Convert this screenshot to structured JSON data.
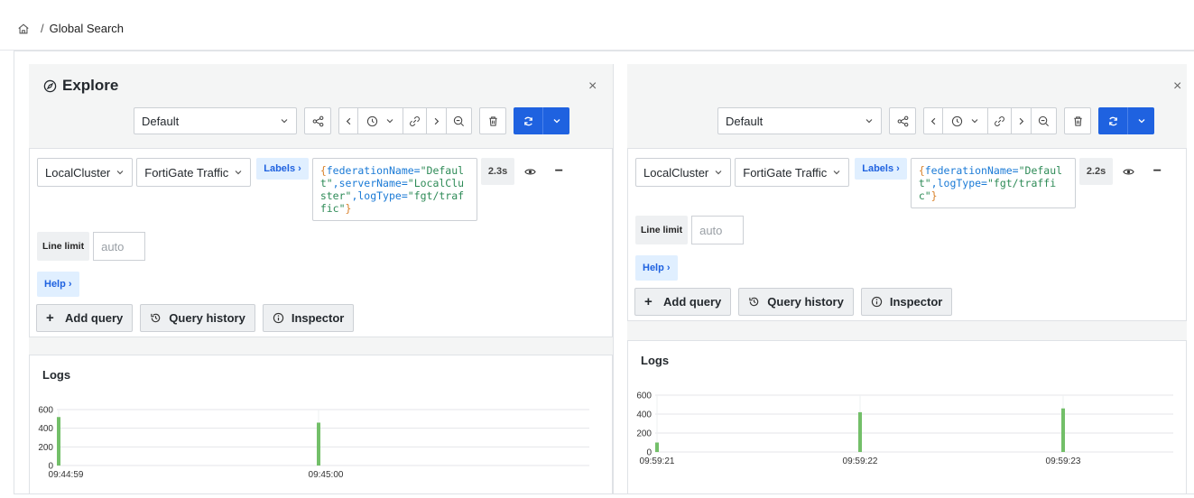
{
  "breadcrumb": {
    "home_icon": "home-icon",
    "separator": "/",
    "current": "Global Search"
  },
  "panes": [
    {
      "title": "Explore",
      "show_title": true,
      "datasource": "Default",
      "query": {
        "cluster": "LocalCluster",
        "source": "FortiGate Traffic",
        "labels_button": "Labels ›",
        "timing": "2.3s",
        "line_limit_label": "Line limit",
        "line_limit_placeholder": "auto",
        "help_button": "Help ›"
      },
      "actions": {
        "add_query": "Add query",
        "query_history": "Query history",
        "inspector": "Inspector"
      },
      "logs_title": "Logs",
      "chart_data": {
        "type": "bar",
        "title": "Logs",
        "x": [
          "09:44:59",
          "09:45:00"
        ],
        "series": [
          {
            "values": [
              520,
              460
            ]
          }
        ],
        "ylim": [
          0,
          600
        ],
        "yticks": [
          0,
          200,
          400,
          600
        ],
        "color": "#73bf69",
        "grid": true
      }
    },
    {
      "title": "",
      "show_title": false,
      "datasource": "Default",
      "query": {
        "cluster": "LocalCluster",
        "source": "FortiGate Traffic",
        "labels_button": "Labels ›",
        "timing": "2.2s",
        "line_limit_label": "Line limit",
        "line_limit_placeholder": "auto",
        "help_button": "Help ›"
      },
      "actions": {
        "add_query": "Add query",
        "query_history": "Query history",
        "inspector": "Inspector"
      },
      "logs_title": "Logs",
      "chart_data": {
        "type": "bar",
        "title": "Logs",
        "x": [
          "09:59:21",
          "09:59:22",
          "09:59:23"
        ],
        "series": [
          {
            "values": [
              100,
              420,
              460
            ]
          }
        ],
        "ylim": [
          0,
          600
        ],
        "yticks": [
          0,
          200,
          400,
          600
        ],
        "color": "#73bf69",
        "grid": true
      }
    }
  ],
  "left_query_text": {
    "p1": "{",
    "p2": "federationName=",
    "p3": "\"Default\"",
    "p4": ",serverName=",
    "p5": "\"LocalCluster\"",
    "p6": ",logType=",
    "p7": "\"fgt/traffic\"",
    "p8": "}"
  },
  "right_query_text": {
    "p1": "{",
    "p2": "federationName=",
    "p3": "\"Default\"",
    "p4": ",logType=",
    "p5": "\"fgt/traffic\"",
    "p6": "}"
  },
  "colors": {
    "primary": "#1f62e0",
    "bar": "#73bf69",
    "link": "#1f62e0",
    "label_bg": "#e0efff"
  },
  "icons": [
    "home-icon",
    "compass-icon",
    "close-icon",
    "share-icon",
    "chevron-left-icon",
    "clock-icon",
    "chevron-down-icon",
    "link-icon",
    "chevron-right-icon",
    "zoom-out-icon",
    "trash-icon",
    "refresh-icon",
    "eye-icon",
    "minus-icon",
    "plus-icon",
    "history-icon",
    "info-icon"
  ]
}
